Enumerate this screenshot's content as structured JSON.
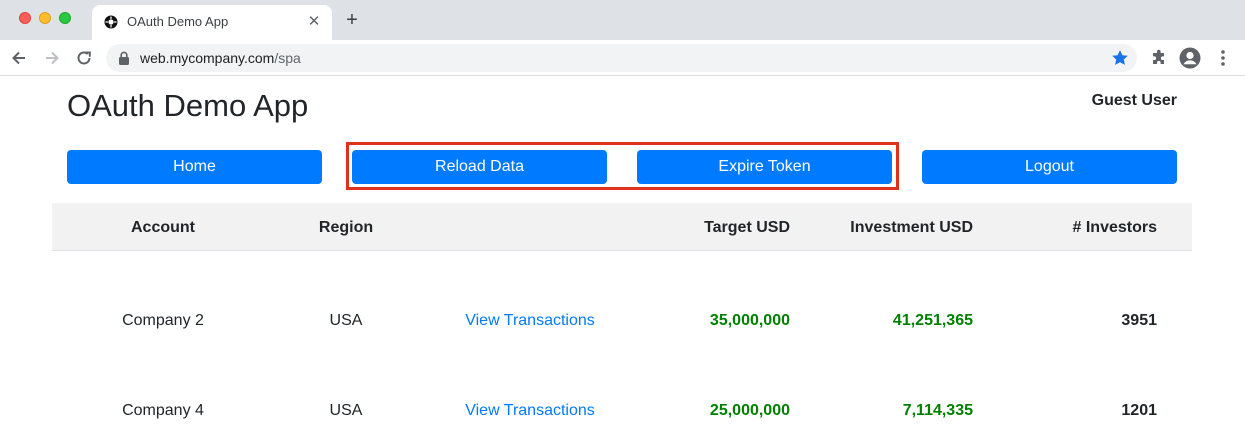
{
  "browser": {
    "tab_title": "OAuth Demo App",
    "tab_close": "✕",
    "new_tab": "+",
    "url_host": "web.mycompany.com",
    "url_path": "/spa",
    "icons": [
      "favicon-icon",
      "back-icon",
      "forward-icon",
      "reload-icon",
      "lock-icon",
      "star-icon",
      "extensions-icon",
      "profile-icon",
      "menu-icon"
    ],
    "accent": "#1a73e8"
  },
  "header": {
    "title": "OAuth Demo App",
    "user": "Guest User"
  },
  "actions": {
    "home": "Home",
    "reload": "Reload Data",
    "expire": "Expire Token",
    "logout": "Logout",
    "button_color": "#007bff",
    "highlight_color": "#e0301e"
  },
  "table": {
    "columns": [
      "Account",
      "Region",
      "",
      "Target USD",
      "Investment USD",
      "# Investors"
    ],
    "rows": [
      {
        "account": "Company 2",
        "region": "USA",
        "link": "View Transactions",
        "target": "35,000,000",
        "investment": "41,251,365",
        "investors": "3951"
      },
      {
        "account": "Company 4",
        "region": "USA",
        "link": "View Transactions",
        "target": "25,000,000",
        "investment": "7,114,335",
        "investors": "1201"
      }
    ],
    "money_color": "#008000",
    "link_color": "#007bff"
  }
}
